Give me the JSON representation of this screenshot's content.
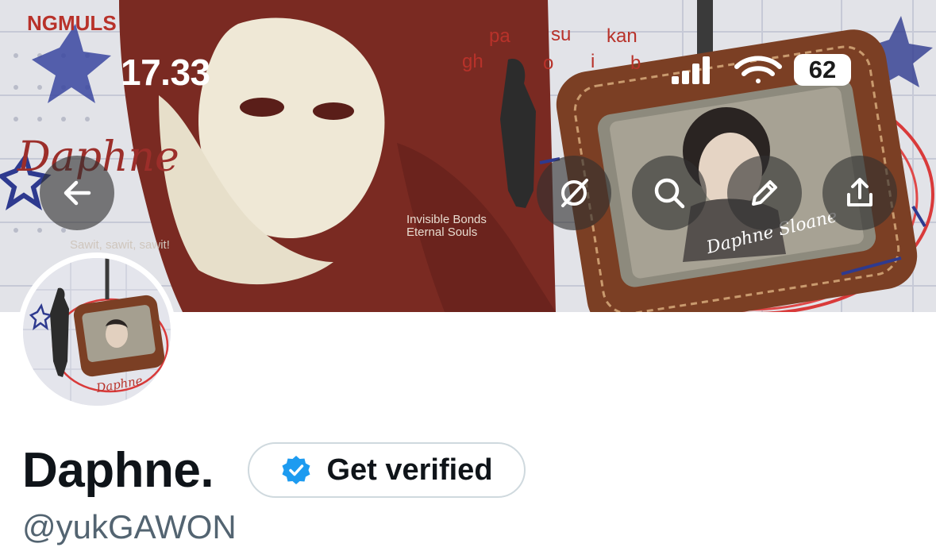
{
  "status_bar": {
    "time": "17.33",
    "battery": "62"
  },
  "banner": {
    "logo_text": "NGMULS",
    "script_name": "Daphne",
    "word_row_top": [
      "pa",
      "su",
      "kan"
    ],
    "word_row_bottom": [
      "gh",
      "o",
      "i",
      "b"
    ],
    "tagline_1": "Invisible Bonds",
    "tagline_2": "Eternal Souls",
    "small_text": "Sawit, sawit, sawit!",
    "card_label": "Daphne Sloane"
  },
  "nav": {
    "back_icon": "arrow-left-icon",
    "actions": [
      "no-circle-icon",
      "search-icon",
      "pencil-icon",
      "share-icon"
    ]
  },
  "avatar": {
    "label": "Daphne"
  },
  "profile": {
    "display_name": "Daphne.",
    "verify_label": "Get verified",
    "handle": "@yukGAWON"
  },
  "colors": {
    "banner_red": "#7a2a22",
    "verify_blue": "#1d9bf0",
    "handle_gray": "#536471"
  }
}
